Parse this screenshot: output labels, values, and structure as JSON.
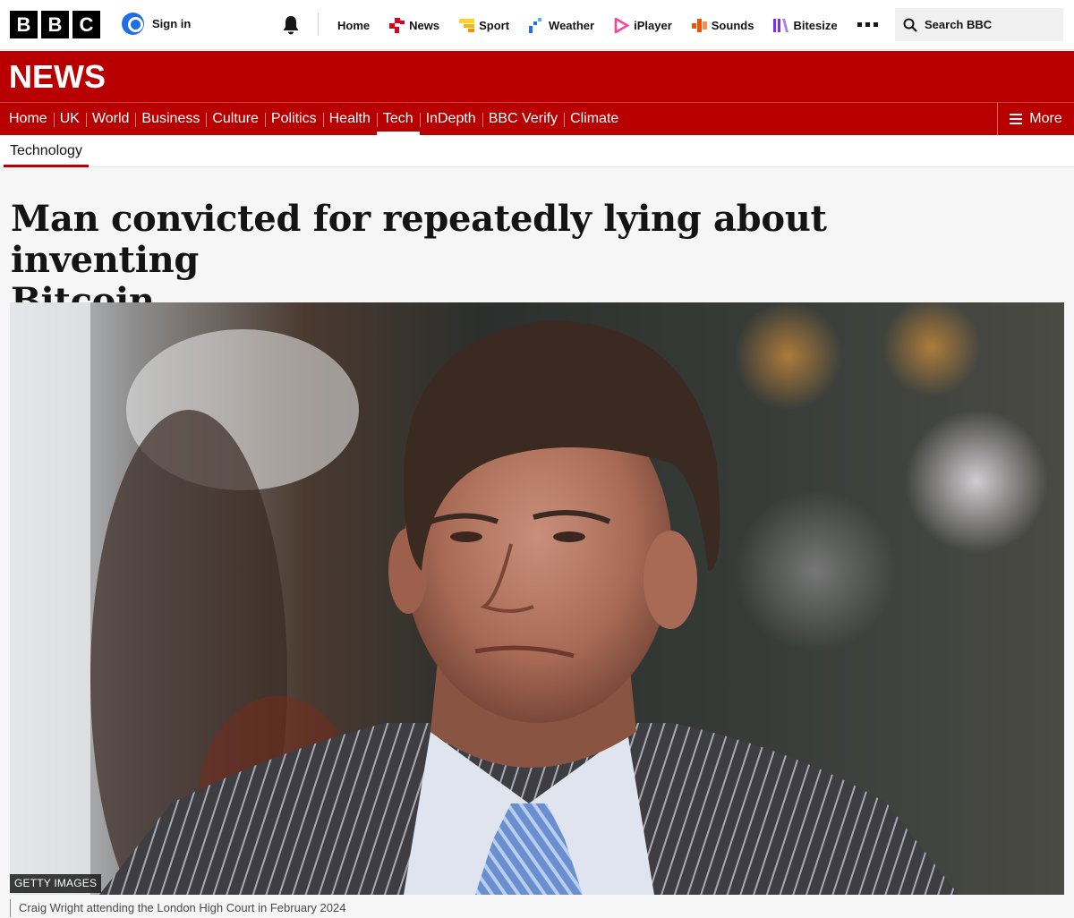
{
  "brand": {
    "letters": [
      "B",
      "B",
      "C"
    ]
  },
  "account": {
    "signin_label": "Sign in"
  },
  "topnav": {
    "items": [
      {
        "label": "Home",
        "icon": ""
      },
      {
        "label": "News",
        "icon": "news-icon",
        "color": "#e0001b"
      },
      {
        "label": "Sport",
        "icon": "sport-icon",
        "color": "#ffd230"
      },
      {
        "label": "Weather",
        "icon": "weather-icon",
        "color": "#1f6fe6"
      },
      {
        "label": "iPlayer",
        "icon": "iplayer-icon",
        "color": "#f54997"
      },
      {
        "label": "Sounds",
        "icon": "sounds-icon",
        "color": "#ff4c00"
      },
      {
        "label": "Bitesize",
        "icon": "bitesize-icon",
        "color": "#7b2ff2"
      }
    ],
    "search_label": "Search BBC"
  },
  "masthead": {
    "title": "NEWS",
    "color": "#b80000"
  },
  "section_nav": {
    "items": [
      "Home",
      "UK",
      "World",
      "Business",
      "Culture",
      "Politics",
      "Health",
      "Tech",
      "InDepth",
      "BBC Verify",
      "Climate"
    ],
    "active": "Tech",
    "more_label": "More"
  },
  "sub_nav": {
    "label": "Technology"
  },
  "article": {
    "headline_line1": "Man convicted for repeatedly lying about inventing",
    "headline_line2": "Bitcoin",
    "image_credit": "GETTY IMAGES",
    "image_caption": "Craig Wright attending the London High Court in February 2024"
  }
}
